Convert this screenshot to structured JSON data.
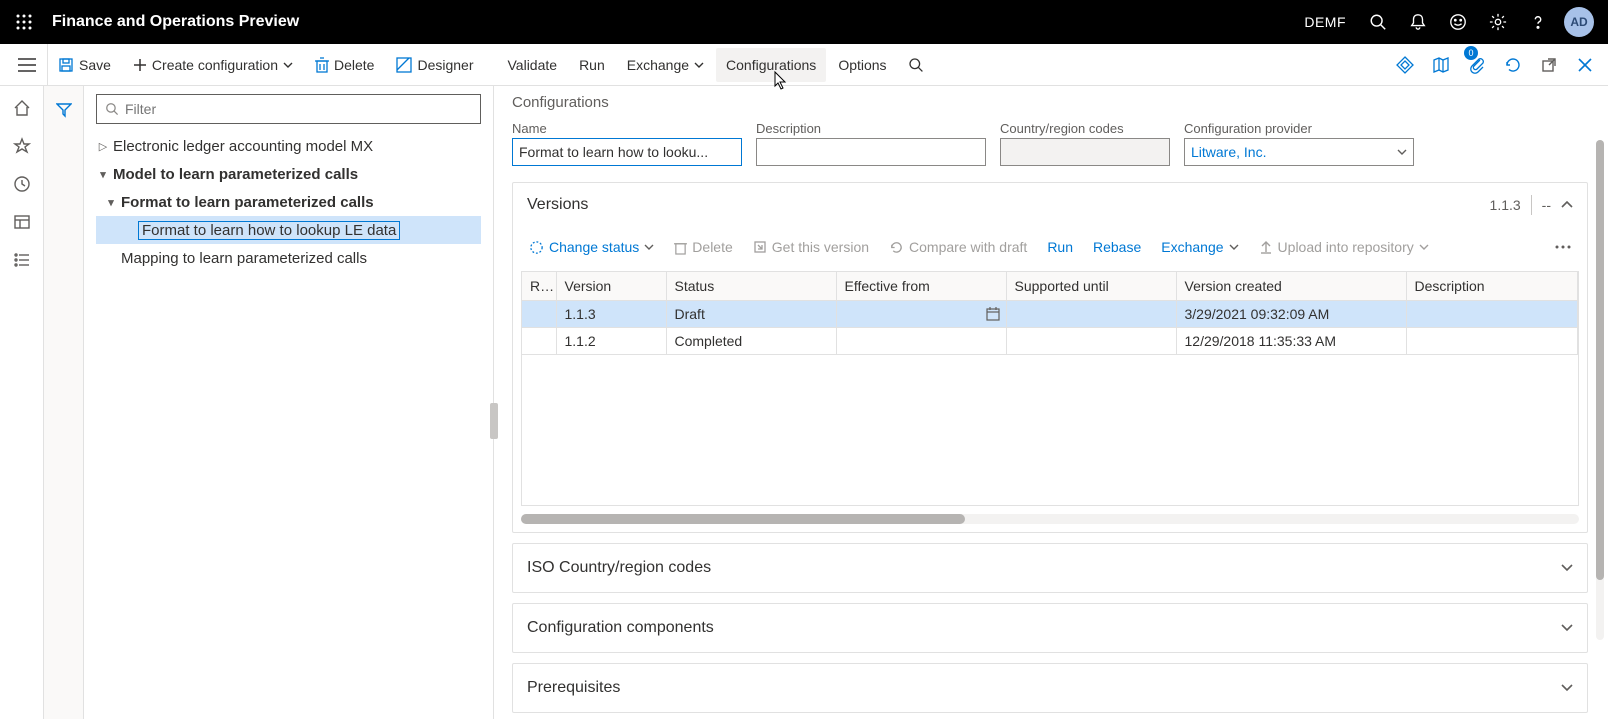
{
  "topbar": {
    "title": "Finance and Operations Preview",
    "company": "DEMF",
    "avatar": "AD"
  },
  "cmdbar": {
    "save": "Save",
    "create": "Create configuration",
    "delete": "Delete",
    "designer": "Designer",
    "validate": "Validate",
    "run": "Run",
    "exchange": "Exchange",
    "configurations": "Configurations",
    "options": "Options",
    "attach_badge": "0"
  },
  "filter": {
    "placeholder": "Filter"
  },
  "tree": {
    "n0": "Electronic ledger accounting model MX",
    "n1": "Model to learn parameterized calls",
    "n2": "Format to learn parameterized calls",
    "n3": "Format to learn how to lookup LE data",
    "n4": "Mapping to learn parameterized calls"
  },
  "detail": {
    "heading": "Configurations",
    "labels": {
      "name": "Name",
      "description": "Description",
      "country": "Country/region codes",
      "provider": "Configuration provider"
    },
    "name_value": "Format to learn how to looku...",
    "description_value": "",
    "country_value": "",
    "provider_value": "Litware, Inc."
  },
  "versions": {
    "title": "Versions",
    "badge": "1.1.3",
    "badge2": "--",
    "toolbar": {
      "change_status": "Change status",
      "delete": "Delete",
      "get": "Get this version",
      "compare": "Compare with draft",
      "run": "Run",
      "rebase": "Rebase",
      "exchange": "Exchange",
      "upload": "Upload into repository"
    },
    "columns": {
      "r": "R...",
      "version": "Version",
      "status": "Status",
      "effective": "Effective from",
      "supported": "Supported until",
      "created": "Version created",
      "description": "Description"
    },
    "rows": [
      {
        "r": "",
        "version": "1.1.3",
        "status": "Draft",
        "effective": "",
        "supported": "",
        "created": "3/29/2021 09:32:09 AM",
        "description": ""
      },
      {
        "r": "",
        "version": "1.1.2",
        "status": "Completed",
        "effective": "",
        "supported": "",
        "created": "12/29/2018 11:35:33 AM",
        "description": ""
      }
    ]
  },
  "sections": {
    "iso": "ISO Country/region codes",
    "components": "Configuration components",
    "prereq": "Prerequisites"
  }
}
